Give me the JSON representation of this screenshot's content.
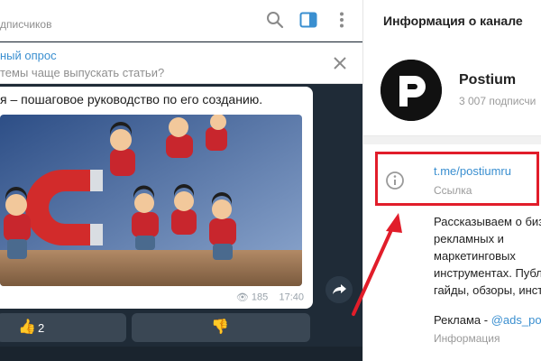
{
  "chat": {
    "subtitle": "дписчиков",
    "header_icons": [
      "search-icon",
      "sidebar-toggle-icon",
      "more-vertical-icon"
    ],
    "accent_color": "#3a8fd0",
    "pinned": {
      "title": "ный опрос",
      "text": "темы чаще выпускать статьи?",
      "close_icon": "close-icon"
    },
    "message": {
      "text": "я – пошаговое руководство по его созданию.",
      "views": "185",
      "time": "17:40",
      "photo_icon": "magnet-figures-image"
    },
    "reactions": [
      {
        "emoji": "👍",
        "count": "2"
      },
      {
        "emoji": "👎",
        "count": ""
      }
    ]
  },
  "info": {
    "title": "Информация о канале",
    "channel_name": "Postium",
    "subscribers": "3 007 подписчи",
    "link": "t.me/postiumru",
    "link_label": "Ссылка",
    "description": "Рассказываем о биз\nрекламных и\nмаркетинговых\nинструментах. Публ\nгайды, обзоры, инст",
    "ads_prefix": "Реклама - ",
    "ads_handle": "@ads_post",
    "ads_label": "Информация"
  },
  "annotation": {
    "highlight_color": "#e11d2a"
  }
}
